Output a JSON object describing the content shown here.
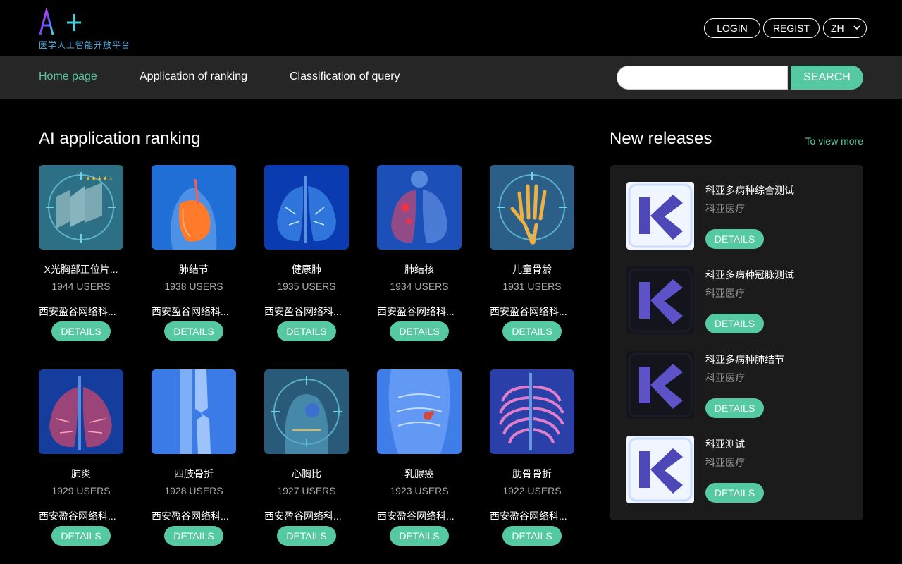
{
  "header": {
    "logo_sub": "医学人工智能开放平台",
    "login_label": "LOGIN",
    "regist_label": "REGIST",
    "lang_value": "ZH"
  },
  "nav": {
    "items": [
      {
        "label": "Home page",
        "active": true
      },
      {
        "label": "Application of ranking"
      },
      {
        "label": "Classification of query"
      }
    ],
    "search_placeholder": "",
    "search_label": "SEARCH"
  },
  "ranking": {
    "title": "AI application ranking",
    "details_label": "DETAILS",
    "cards": [
      {
        "name": "X光胸部正位片...",
        "users": "1944 USERS",
        "org": "西安盈谷网络科...",
        "icon": "xray-film-icon"
      },
      {
        "name": "肺结节",
        "users": "1938 USERS",
        "org": "西安盈谷网络科...",
        "icon": "lung-nodule-icon"
      },
      {
        "name": "健康肺",
        "users": "1935 USERS",
        "org": "西安盈谷网络科...",
        "icon": "healthy-lung-icon"
      },
      {
        "name": "肺结核",
        "users": "1934 USERS",
        "org": "西安盈谷网络科...",
        "icon": "tuberculosis-lung-icon"
      },
      {
        "name": "儿童骨龄",
        "users": "1931 USERS",
        "org": "西安盈谷网络科...",
        "icon": "hand-bone-icon"
      },
      {
        "name": "肺炎",
        "users": "1929 USERS",
        "org": "西安盈谷网络科...",
        "icon": "pneumonia-lung-icon"
      },
      {
        "name": "四肢骨折",
        "users": "1928 USERS",
        "org": "西安盈谷网络科...",
        "icon": "limb-fracture-icon"
      },
      {
        "name": "心胸比",
        "users": "1927 USERS",
        "org": "西安盈谷网络科...",
        "icon": "heart-chest-icon"
      },
      {
        "name": "乳腺癌",
        "users": "1923 USERS",
        "org": "西安盈谷网络科...",
        "icon": "breast-cancer-icon"
      },
      {
        "name": "肋骨骨折",
        "users": "1922 USERS",
        "org": "西安盈谷网络科...",
        "icon": "rib-fracture-icon"
      }
    ]
  },
  "releases": {
    "title": "New releases",
    "view_more": "To view more",
    "details_label": "DETAILS",
    "items": [
      {
        "title": "科亚多病种综合测试",
        "org": "科亚医疗",
        "theme": "light"
      },
      {
        "title": "科亚多病种冠脉测试",
        "org": "科亚医疗",
        "theme": "dark"
      },
      {
        "title": "科亚多病种肺结节",
        "org": "科亚医疗",
        "theme": "dark"
      },
      {
        "title": "科亚测试",
        "org": "科亚医疗",
        "theme": "light"
      }
    ]
  },
  "colors": {
    "accent": "#55c9a2",
    "nav_bg": "#262626",
    "panel_bg": "#1b1b1b",
    "logo_sub": "#4fb4e6"
  }
}
